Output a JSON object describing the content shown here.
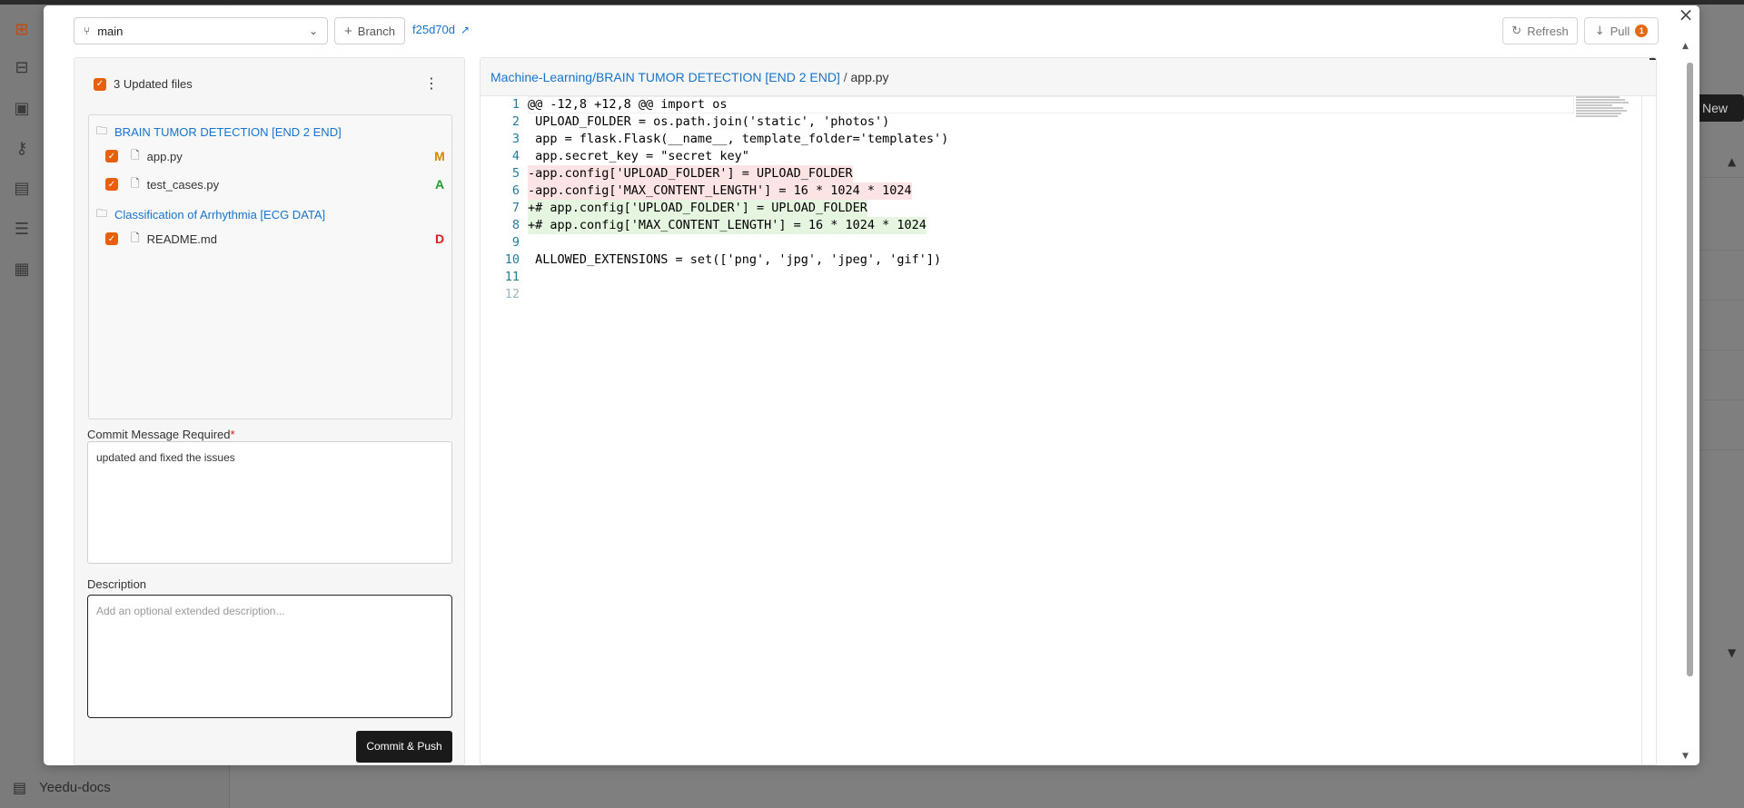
{
  "background": {
    "docs_label": "Yeedu-docs",
    "new_button_label": "New"
  },
  "toolbar": {
    "branch": "main",
    "branch_button_label": "Branch",
    "commit_hash": "f25d70d",
    "refresh_label": "Refresh",
    "pull_label": "Pull",
    "pull_badge": "1"
  },
  "files_panel": {
    "title": "3 Updated files",
    "folders": [
      {
        "name": "BRAIN TUMOR DETECTION [END 2 END]",
        "files": [
          {
            "name": "app.py",
            "status": "M"
          },
          {
            "name": "test_cases.py",
            "status": "A"
          }
        ]
      },
      {
        "name": "Classification of Arrhythmia [ECG DATA]",
        "files": [
          {
            "name": "README.md",
            "status": "D"
          }
        ]
      }
    ]
  },
  "commit": {
    "message_label": "Commit Message Required",
    "required_marker": "*",
    "message_value": "updated and fixed the issues",
    "description_label": "Description",
    "description_placeholder": "Add an optional extended description...",
    "button_label": "Commit & Push"
  },
  "diff": {
    "path_link": "Machine-Learning/BRAIN TUMOR DETECTION [END 2 END]",
    "path_sep": " / ",
    "path_file": "app.py",
    "lines": [
      {
        "n": "1",
        "text": "@@ -12,8 +12,8 @@ import os",
        "kind": "hunk"
      },
      {
        "n": "2",
        "text": " UPLOAD_FOLDER = os.path.join('static', 'photos')",
        "kind": "ctx"
      },
      {
        "n": "3",
        "text": " app = flask.Flask(__name__, template_folder='templates')",
        "kind": "ctx"
      },
      {
        "n": "4",
        "text": " app.secret_key = \"secret key\"",
        "kind": "ctx"
      },
      {
        "n": "5",
        "text": "-app.config['UPLOAD_FOLDER'] = UPLOAD_FOLDER",
        "kind": "del"
      },
      {
        "n": "6",
        "text": "-app.config['MAX_CONTENT_LENGTH'] = 16 * 1024 * 1024",
        "kind": "del"
      },
      {
        "n": "7",
        "text": "+# app.config['UPLOAD_FOLDER'] = UPLOAD_FOLDER",
        "kind": "add"
      },
      {
        "n": "8",
        "text": "+# app.config['MAX_CONTENT_LENGTH'] = 16 * 1024 * 1024",
        "kind": "add"
      },
      {
        "n": "9",
        "text": " ",
        "kind": "ctx"
      },
      {
        "n": "10",
        "text": " ALLOWED_EXTENSIONS = set(['png', 'jpg', 'jpeg', 'gif'])",
        "kind": "ctx"
      },
      {
        "n": "11",
        "text": "",
        "kind": "ctx"
      },
      {
        "n": "12",
        "text": "",
        "kind": "faint"
      }
    ]
  },
  "colors": {
    "accent": "#e8600e",
    "link": "#1a73c9",
    "status_modified": "#d08a00",
    "status_added": "#22a033",
    "status_deleted": "#d92020"
  }
}
